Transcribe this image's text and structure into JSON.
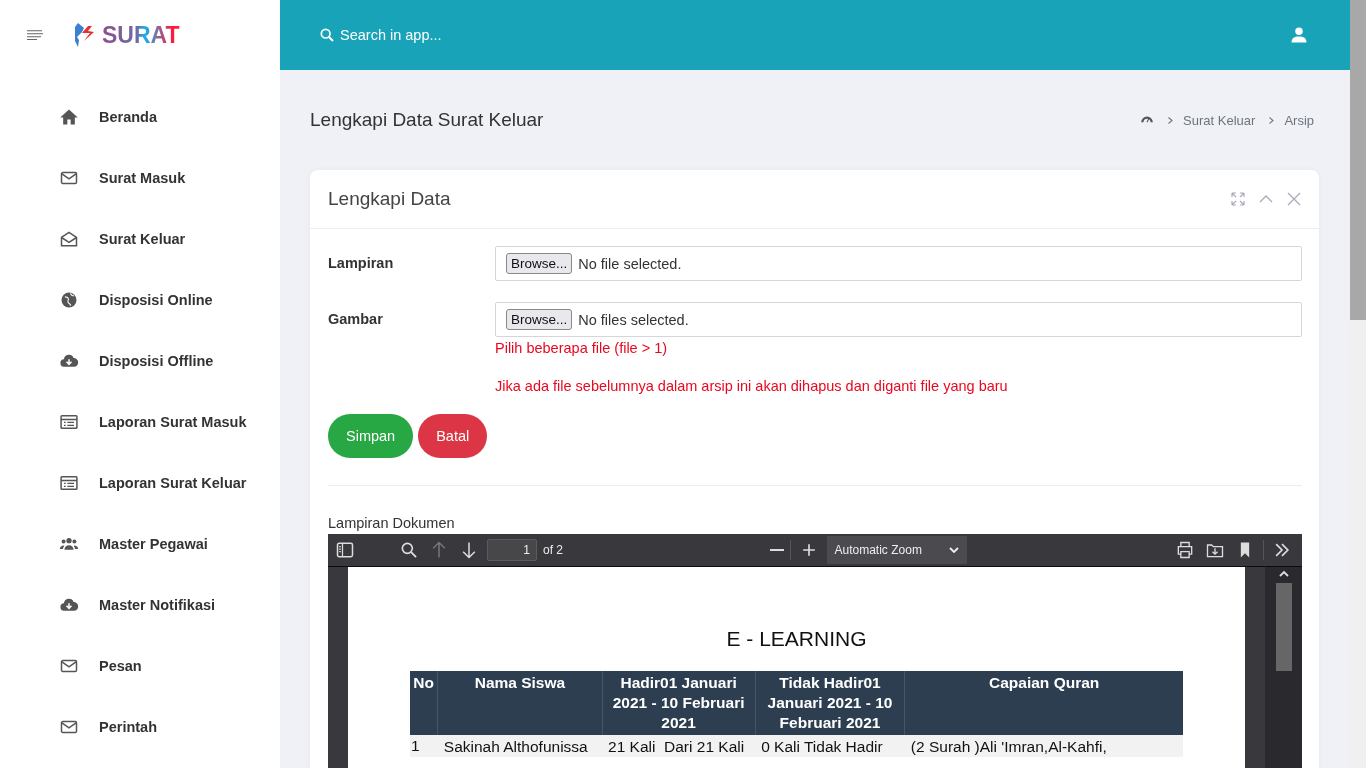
{
  "brand": {
    "logo_text": "SURAT"
  },
  "sidebar": {
    "items": [
      {
        "label": "Beranda"
      },
      {
        "label": "Surat Masuk"
      },
      {
        "label": "Surat Keluar"
      },
      {
        "label": "Disposisi Online"
      },
      {
        "label": "Disposisi Offline"
      },
      {
        "label": "Laporan Surat Masuk"
      },
      {
        "label": "Laporan Surat Keluar"
      },
      {
        "label": "Master Pegawai"
      },
      {
        "label": "Master Notifikasi"
      },
      {
        "label": "Pesan"
      },
      {
        "label": "Perintah"
      }
    ]
  },
  "topbar": {
    "search": {
      "placeholder": "Search in app..."
    }
  },
  "page": {
    "title": "Lengkapi Data Surat Keluar",
    "breadcrumb": [
      "Surat Keluar",
      "Arsip"
    ]
  },
  "card": {
    "title": "Lengkapi Data",
    "fields": [
      {
        "label": "Lampiran",
        "button": "Browse...",
        "status": "No file selected."
      },
      {
        "label": "Gambar",
        "button": "Browse...",
        "status": "No files selected.",
        "notes": [
          "Pilih beberapa file (file > 1)",
          "Jika ada file sebelumnya dalam arsip ini akan dihapus dan diganti file yang baru"
        ]
      }
    ],
    "buttons": [
      {
        "label": "Simpan",
        "kind": "success"
      },
      {
        "label": "Batal",
        "kind": "danger"
      }
    ]
  },
  "viewer": {
    "label": "Lampiran Dokumen",
    "page_number": "1",
    "page_count": "of 2",
    "zoom": "Automatic Zoom",
    "document": {
      "title": "E - LEARNING",
      "columns": [
        "No",
        "Nama Siswa",
        "Hadir01 Januari 2021 - 10 Februari 2021",
        "Tidak Hadir01 Januari 2021 - 10 Februari 2021",
        "Capaian Quran"
      ],
      "rows": [
        [
          "1",
          "Sakinah Althofunissa",
          "21 Kali  Dari 21 Kali",
          "0 Kali Tidak Hadir",
          "(2 Surah )Ali 'Imran,Al-Kahfi,"
        ]
      ]
    }
  }
}
